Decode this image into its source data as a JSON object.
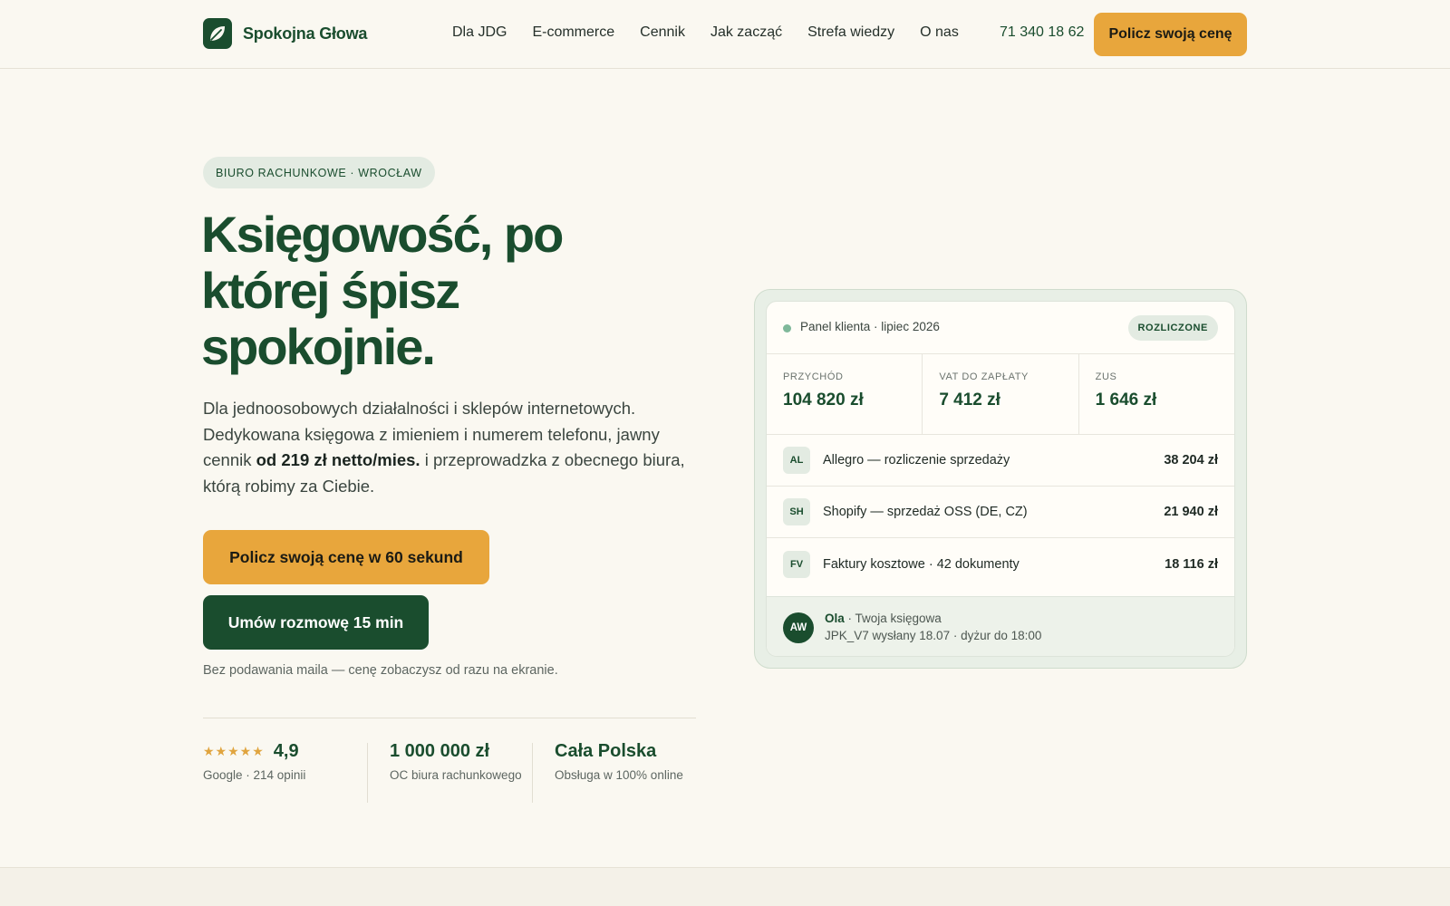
{
  "brand": {
    "name": "Spokojna Głowa",
    "logo_icon": "leaf-icon",
    "primary_color": "#1a4d2e",
    "accent_color": "#e8a63c"
  },
  "nav": {
    "links": [
      "Dla JDG",
      "E-commerce",
      "Cennik",
      "Jak zacząć",
      "Strefa wiedzy",
      "O nas"
    ],
    "phone": "71 340 18 62",
    "cta": "Policz swoją cenę"
  },
  "hero": {
    "eyebrow": "BIURO RACHUNKOWE · WROCŁAW",
    "headline": "Księgowość, po której śpisz spokojnie.",
    "lead_before": "Dla jednoosobowych działalności i sklepów internetowych. Dedykowana księgowa z imieniem i numerem telefonu, jawny cennik ",
    "lead_bold": "od 219 zł netto/mies.",
    "lead_after": " i przeprowadzka z obecnego biura, którą robimy za Ciebie.",
    "primary_cta": "Policz swoją cenę w 60 sekund",
    "secondary_cta": "Umów rozmowę 15 min",
    "note": "Bez podawania maila — cenę zobaczysz od razu na ekranie."
  },
  "stats": [
    {
      "stars": "★★★★★",
      "value": "4,9",
      "label": "Google · 214 opinii"
    },
    {
      "value": "1 000 000 zł",
      "label": "OC biura rachunkowego"
    },
    {
      "value": "Cała Polska",
      "label": "Obsługa w 100% online"
    }
  ],
  "panel": {
    "title": "Panel klienta · lipiec 2026",
    "status": "ROZLICZONE",
    "metrics": [
      {
        "label": "PRZYCHÓD",
        "value": "104 820 zł"
      },
      {
        "label": "VAT DO ZAPŁATY",
        "value": "7 412 zł"
      },
      {
        "label": "ZUS",
        "value": "1 646 zł"
      }
    ],
    "rows": [
      {
        "code": "AL",
        "text": "Allegro — rozliczenie sprzedaży",
        "amount": "38 204 zł"
      },
      {
        "code": "SH",
        "text": "Shopify — sprzedaż OSS (DE, CZ)",
        "amount": "21 940 zł"
      },
      {
        "code": "FV",
        "text": "Faktury kosztowe · 42 dokumenty",
        "amount": "18 116 zł"
      }
    ],
    "footer": {
      "initials": "AW",
      "name": "Ola",
      "role": " · Twoja księgowa",
      "status": "JPK_V7 wysłany 18.07 · dyżur do 18:00"
    }
  }
}
